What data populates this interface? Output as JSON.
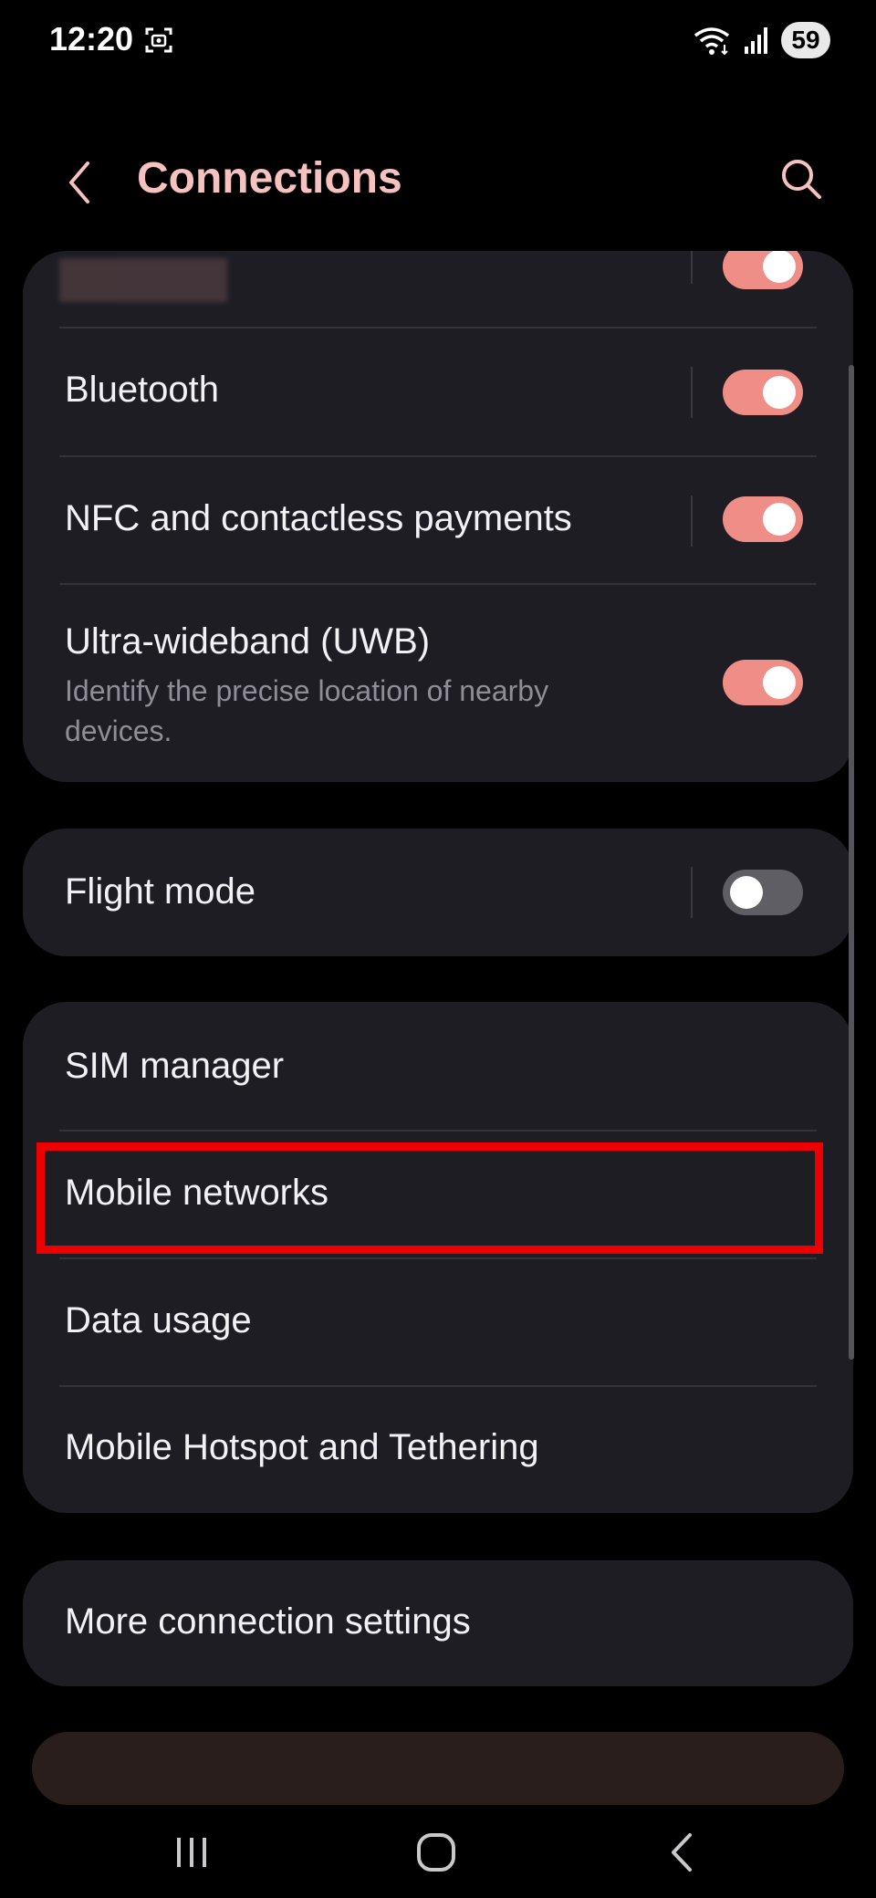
{
  "status_bar": {
    "time": "12:20",
    "battery": "59",
    "icons": [
      "screenshot-icon",
      "wifi-icon",
      "signal-icon",
      "battery-icon"
    ]
  },
  "header": {
    "title": "Connections",
    "back_icon": "chevron-left-icon",
    "search_icon": "search-icon"
  },
  "groups": [
    {
      "items": [
        {
          "label": "",
          "toggle": "on",
          "redacted": true
        },
        {
          "label": "Bluetooth",
          "toggle": "on"
        },
        {
          "label": "NFC and contactless payments",
          "toggle": "on"
        },
        {
          "label": "Ultra-wideband (UWB)",
          "description": "Identify the precise location of nearby devices.",
          "toggle": "on"
        }
      ]
    },
    {
      "items": [
        {
          "label": "Flight mode",
          "toggle": "off"
        }
      ]
    },
    {
      "items": [
        {
          "label": "SIM manager"
        },
        {
          "label": "Mobile networks",
          "highlighted": true
        },
        {
          "label": "Data usage"
        },
        {
          "label": "Mobile Hotspot and Tethering"
        }
      ]
    },
    {
      "items": [
        {
          "label": "More connection settings"
        }
      ]
    }
  ],
  "colors": {
    "accent": "#ef8d87",
    "title": "#f6c2bf",
    "card": "#1e1d24",
    "highlight": "#ee0000"
  },
  "nav_bar": {
    "icons": [
      "recents-icon",
      "home-icon",
      "back-icon"
    ]
  }
}
